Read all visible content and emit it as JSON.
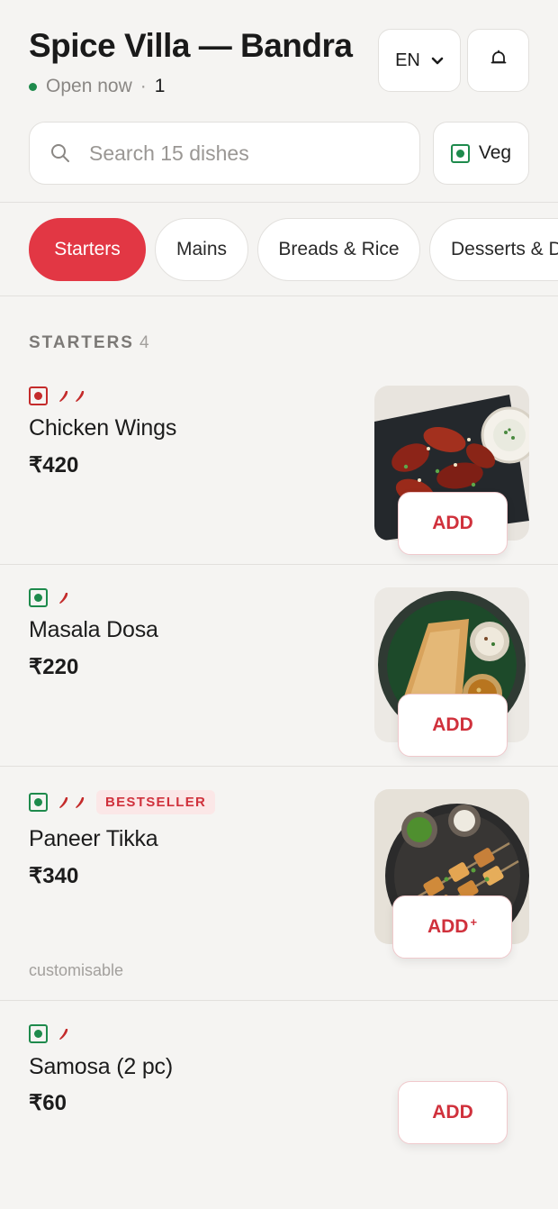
{
  "header": {
    "restaurant_name": "Spice Villa — Bandra",
    "status": "Open now",
    "separator": "·",
    "count": "1",
    "language": "EN"
  },
  "search": {
    "placeholder": "Search 15 dishes",
    "value": ""
  },
  "veg_filter": {
    "label": "Veg"
  },
  "tabs": [
    {
      "label": "Starters",
      "active": true
    },
    {
      "label": "Mains",
      "active": false
    },
    {
      "label": "Breads & Rice",
      "active": false
    },
    {
      "label": "Desserts & Drinks",
      "active": false
    }
  ],
  "section": {
    "title": "STARTERS",
    "count": "4"
  },
  "dishes": [
    {
      "name": "Chicken Wings",
      "price": "₹420",
      "diet": "non-veg",
      "spice_level": 2,
      "badge": "",
      "note": "",
      "add_label": "ADD",
      "add_suffix": "",
      "image_icon": "chicken-wings-photo"
    },
    {
      "name": "Masala Dosa",
      "price": "₹220",
      "diet": "veg",
      "spice_level": 1,
      "badge": "",
      "note": "",
      "add_label": "ADD",
      "add_suffix": "",
      "image_icon": "masala-dosa-photo"
    },
    {
      "name": "Paneer Tikka",
      "price": "₹340",
      "diet": "veg",
      "spice_level": 2,
      "badge": "BESTSELLER",
      "note": "customisable",
      "add_label": "ADD",
      "add_suffix": "+",
      "image_icon": "paneer-tikka-photo"
    },
    {
      "name": "Samosa (2 pc)",
      "price": "₹60",
      "diet": "veg",
      "spice_level": 1,
      "badge": "",
      "note": "",
      "add_label": "ADD",
      "add_suffix": "",
      "image_icon": ""
    }
  ],
  "colors": {
    "accent": "#e23744",
    "veg": "#1e8a4c",
    "non_veg": "#c42b2b",
    "background": "#f5f4f2"
  }
}
